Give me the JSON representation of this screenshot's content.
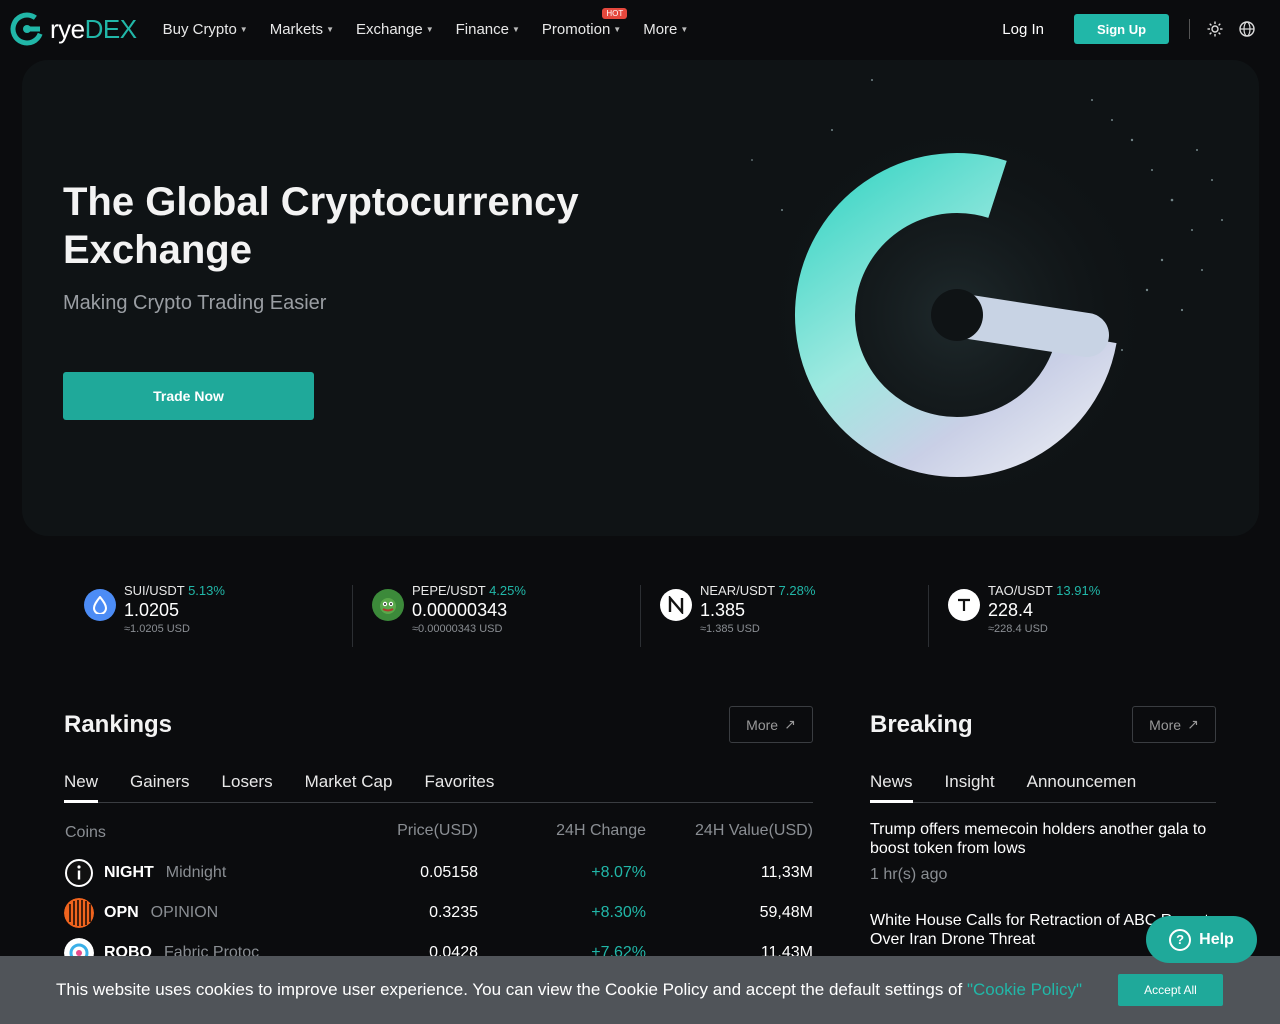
{
  "brand": {
    "name_part1": "rye",
    "name_part2": "DEX",
    "accent": "#21b7a8"
  },
  "nav": {
    "items": [
      {
        "label": "Buy Crypto"
      },
      {
        "label": "Markets"
      },
      {
        "label": "Exchange"
      },
      {
        "label": "Finance"
      },
      {
        "label": "Promotion",
        "badge": "HOT"
      },
      {
        "label": "More"
      }
    ],
    "login": "Log In",
    "signup": "Sign Up"
  },
  "hero": {
    "title": " The Global Cryptocurrency Exchange",
    "subtitle": "Making Crypto Trading Easier",
    "cta": "Trade Now"
  },
  "tickers": [
    {
      "pair": "SUI/USDT",
      "change": "5.13%",
      "price": "1.0205",
      "usd": "≈1.0205 USD",
      "icon": "sui-icon"
    },
    {
      "pair": "PEPE/USDT",
      "change": "4.25%",
      "price": "0.00000343",
      "usd": "≈0.00000343 USD",
      "icon": "pepe-icon"
    },
    {
      "pair": "NEAR/USDT",
      "change": "7.28%",
      "price": "1.385",
      "usd": "≈1.385 USD",
      "icon": "near-icon"
    },
    {
      "pair": "TAO/USDT",
      "change": "13.91%",
      "price": "228.4",
      "usd": "≈228.4 USD",
      "icon": "tao-icon"
    }
  ],
  "rankings": {
    "title": "Rankings",
    "more": "More",
    "tabs": [
      "New",
      "Gainers",
      "Losers",
      "Market Cap",
      "Favorites"
    ],
    "columns": [
      "Coins",
      "Price(USD)",
      "24H Change",
      "24H Value(USD)"
    ],
    "rows": [
      {
        "symbol": "NIGHT",
        "name": "Midnight",
        "price": "0.05158",
        "change": "+8.07%",
        "value": "11,33M"
      },
      {
        "symbol": "OPN",
        "name": "OPINION",
        "price": "0.3235",
        "change": "+8.30%",
        "value": "59,48M"
      },
      {
        "symbol": "ROBO",
        "name": "Fabric Protoc",
        "price": "0.0428",
        "change": "+7.62%",
        "value": "11,43M"
      }
    ]
  },
  "breaking": {
    "title": "Breaking",
    "more": "More",
    "tabs": [
      "News",
      "Insight",
      "Announcemen"
    ],
    "items": [
      {
        "title": "Trump offers memecoin holders another gala to boost token from lows",
        "time": "1 hr(s) ago"
      },
      {
        "title": "White House Calls for Retraction of ABC Report Over Iran Drone Threat",
        "time": ""
      }
    ]
  },
  "help": {
    "label": "Help"
  },
  "cookie": {
    "text": "This website uses cookies to improve user experience. You can view the Cookie Policy and accept the default settings of ",
    "link": "\"Cookie Policy\"",
    "accept": "Accept All"
  }
}
